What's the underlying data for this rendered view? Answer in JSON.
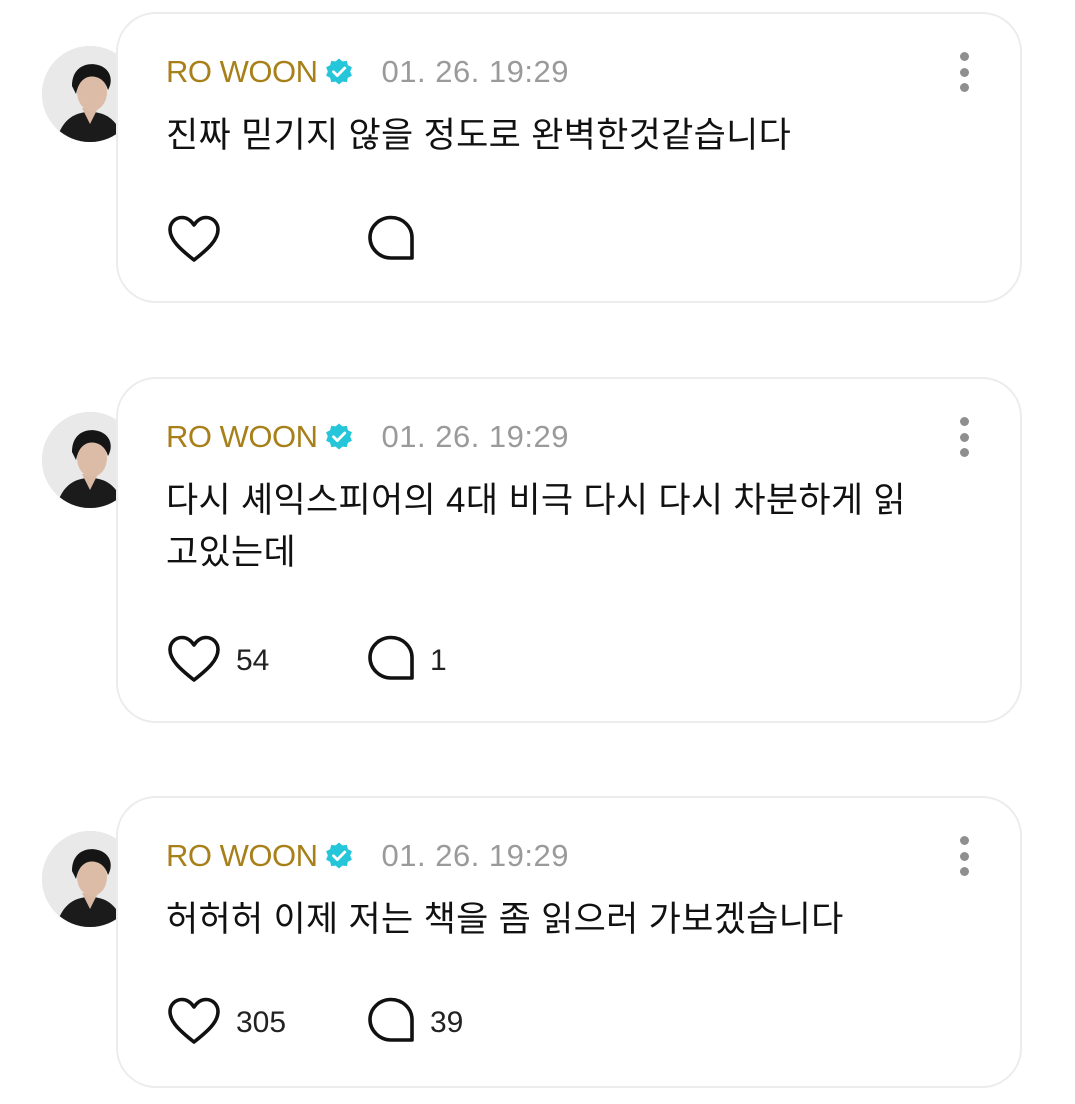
{
  "posts": [
    {
      "author": "RO WOON",
      "time": "01. 26. 19:29",
      "text": "진짜 믿기지 않을 정도로 완벽한것같습니다",
      "likes": "",
      "comments": ""
    },
    {
      "author": "RO WOON",
      "time": "01. 26. 19:29",
      "text": "다시 셰익스피어의 4대 비극 다시 다시 차분하게 읽고있는데",
      "likes": "54",
      "comments": "1"
    },
    {
      "author": "RO WOON",
      "time": "01. 26. 19:29",
      "text": "허허허 이제 저는 책을 좀 읽으러 가보겠습니다",
      "likes": "305",
      "comments": "39"
    }
  ],
  "icons": {
    "verified": "verified-badge-icon",
    "like": "heart-icon",
    "comment": "speech-bubble-icon",
    "more": "more-vertical-icon"
  },
  "colors": {
    "author": "#a8801a",
    "verified": "#26c6da",
    "timestamp": "#9a9a9a",
    "card_border": "#ececec"
  }
}
